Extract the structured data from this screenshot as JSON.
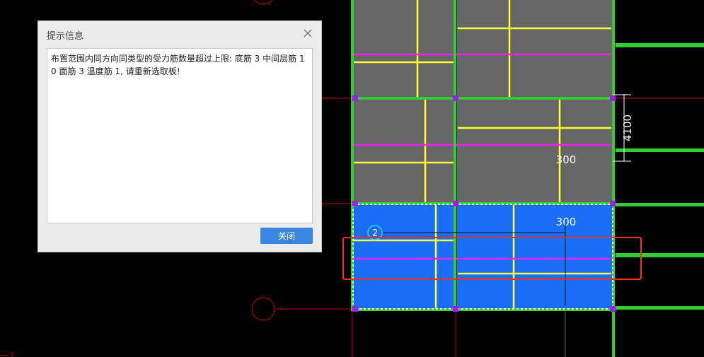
{
  "dialog": {
    "title": "提示信息",
    "message": "布置范围内同方向同类型的受力筋数量超过上限: 底筋 3 中间层筋 10 面筋 3 温度筋 1, 请重新选取板!",
    "close_button": "关闭",
    "close_icon": "close-icon"
  },
  "drawing": {
    "dim_vertical": "4100",
    "dim_upper": "300",
    "dim_lower": "300",
    "axis_bubble": "2",
    "coord_axis_label": "Y",
    "colors": {
      "background": "#000000",
      "beam": "#33cc33",
      "slab": "#666666",
      "slab_selected": "#1a6ef5",
      "rebar": "#ffff33",
      "rebar_magenta": "#ee22ee",
      "axis_red": "#cc0000",
      "highlight_box": "#ff2a1a"
    }
  }
}
